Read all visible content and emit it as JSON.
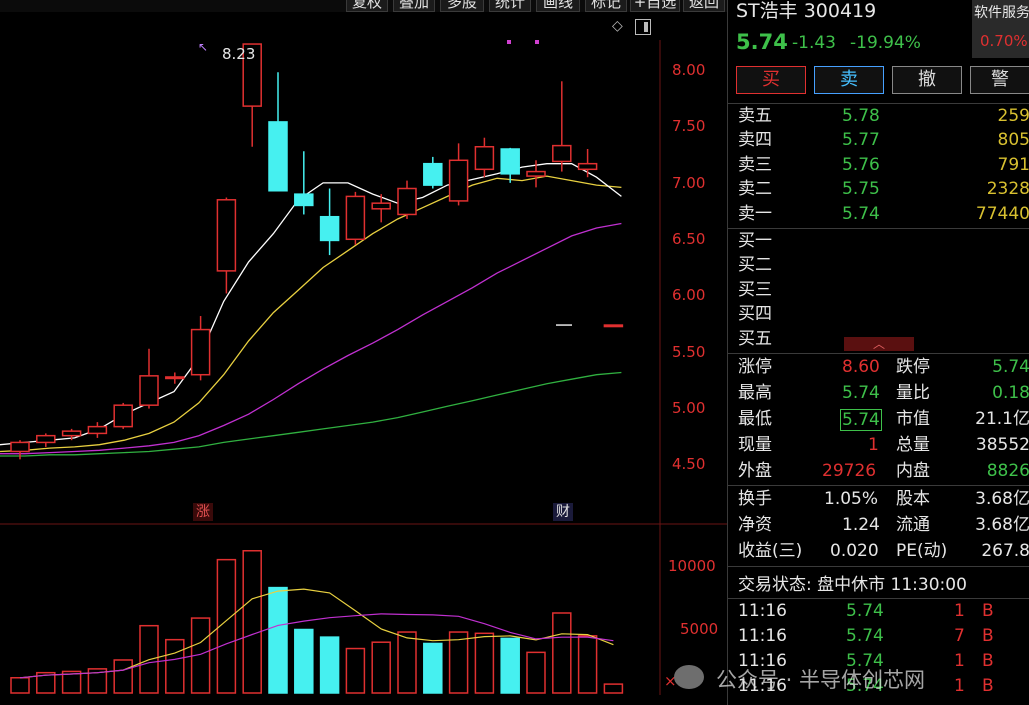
{
  "toolbar": {
    "buttons": [
      "复权",
      "叠加",
      "多股",
      "统计",
      "画线",
      "标记",
      "+自选",
      "返回"
    ]
  },
  "chart": {
    "price_axis": [
      "8.00",
      "7.50",
      "7.00",
      "6.50",
      "6.00",
      "5.50",
      "5.00",
      "4.50"
    ],
    "volume_axis": [
      "10000",
      "5000"
    ],
    "volume_unit": "×",
    "high_marker": "8.23",
    "tag_limit_up": "涨",
    "tag_finance": "财"
  },
  "stock": {
    "name_code": "ST浩丰 300419",
    "price": "5.74",
    "change": "-1.43",
    "change_pct": "-19.94%",
    "sector_label": "软件服务",
    "sector_pct": "0.70%"
  },
  "actions": {
    "buy": "买",
    "sell": "卖",
    "cancel": "撤",
    "alert": "警"
  },
  "order_book": {
    "asks": [
      {
        "label": "卖五",
        "price": "5.78",
        "vol": "259"
      },
      {
        "label": "卖四",
        "price": "5.77",
        "vol": "805"
      },
      {
        "label": "卖三",
        "price": "5.76",
        "vol": "791"
      },
      {
        "label": "卖二",
        "price": "5.75",
        "vol": "2328"
      },
      {
        "label": "卖一",
        "price": "5.74",
        "vol": "77440"
      }
    ],
    "bids": [
      {
        "label": "买一"
      },
      {
        "label": "买二"
      },
      {
        "label": "买三"
      },
      {
        "label": "买四"
      },
      {
        "label": "买五"
      }
    ]
  },
  "stats": {
    "limit_up_label": "涨停",
    "limit_up": "8.60",
    "limit_down_label": "跌停",
    "limit_down": "5.74",
    "high_label": "最高",
    "high": "5.74",
    "vol_ratio_label": "量比",
    "vol_ratio": "0.18",
    "low_label": "最低",
    "low": "5.74",
    "mkt_cap_label": "市值",
    "mkt_cap": "21.1亿",
    "cur_vol_label": "现量",
    "cur_vol": "1",
    "total_vol_label": "总量",
    "total_vol": "38552",
    "outer_label": "外盘",
    "outer": "29726",
    "inner_label": "内盘",
    "inner": "8826",
    "turnover_label": "换手",
    "turnover": "1.05%",
    "equity_label": "股本",
    "equity": "3.68亿",
    "nav_label": "净资",
    "nav": "1.24",
    "float_label": "流通",
    "float": "3.68亿",
    "eps_label": "收益(三)",
    "eps": "0.020",
    "pe_label": "PE(动)",
    "pe": "267.8"
  },
  "trade_status": "交易状态: 盘中休市 11:30:00",
  "ticks": [
    {
      "time": "11:16",
      "price": "5.74",
      "vol": "1",
      "side": "B"
    },
    {
      "time": "11:16",
      "price": "5.74",
      "vol": "7",
      "side": "B"
    },
    {
      "time": "11:16",
      "price": "5.74",
      "vol": "1",
      "side": "B"
    },
    {
      "time": "11:16",
      "price": "5.74",
      "vol": "1",
      "side": "B"
    }
  ],
  "watermark": "公众号 · 半导体创芯网",
  "colors": {
    "up": "#e03030",
    "down": "#46f0f0",
    "ma5": "#ffffff",
    "ma10": "#e8d040",
    "ma20": "#c030d0",
    "ma60": "#30b040"
  },
  "chart_data": {
    "type": "candlestick",
    "candles": [
      {
        "o": 4.62,
        "h": 4.72,
        "l": 4.55,
        "c": 4.7,
        "v": 1200
      },
      {
        "o": 4.7,
        "h": 4.78,
        "l": 4.66,
        "c": 4.76,
        "v": 1600
      },
      {
        "o": 4.76,
        "h": 4.82,
        "l": 4.72,
        "c": 4.8,
        "v": 1700
      },
      {
        "o": 4.78,
        "h": 4.88,
        "l": 4.74,
        "c": 4.84,
        "v": 1900
      },
      {
        "o": 4.84,
        "h": 5.05,
        "l": 4.82,
        "c": 5.03,
        "v": 2600
      },
      {
        "o": 5.03,
        "h": 5.53,
        "l": 5.0,
        "c": 5.29,
        "v": 5300
      },
      {
        "o": 5.27,
        "h": 5.32,
        "l": 5.22,
        "c": 5.28,
        "v": 4200
      },
      {
        "o": 5.3,
        "h": 5.82,
        "l": 5.25,
        "c": 5.7,
        "v": 5900
      },
      {
        "o": 6.22,
        "h": 6.87,
        "l": 6.02,
        "c": 6.85,
        "v": 10500
      },
      {
        "o": 7.68,
        "h": 8.23,
        "l": 7.32,
        "c": 8.23,
        "v": 11200
      },
      {
        "o": 7.54,
        "h": 7.98,
        "l": 6.93,
        "c": 6.93,
        "v": 8300
      },
      {
        "o": 6.9,
        "h": 7.28,
        "l": 6.72,
        "c": 6.8,
        "v": 5000
      },
      {
        "o": 6.7,
        "h": 6.95,
        "l": 6.36,
        "c": 6.49,
        "v": 4400
      },
      {
        "o": 6.5,
        "h": 6.92,
        "l": 6.45,
        "c": 6.88,
        "v": 3500
      },
      {
        "o": 6.77,
        "h": 6.9,
        "l": 6.65,
        "c": 6.82,
        "v": 4000
      },
      {
        "o": 6.72,
        "h": 7.02,
        "l": 6.68,
        "c": 6.95,
        "v": 4800
      },
      {
        "o": 7.17,
        "h": 7.23,
        "l": 6.95,
        "c": 6.98,
        "v": 3900
      },
      {
        "o": 6.84,
        "h": 7.35,
        "l": 6.8,
        "c": 7.2,
        "v": 4800
      },
      {
        "o": 7.12,
        "h": 7.4,
        "l": 7.05,
        "c": 7.32,
        "v": 4700
      },
      {
        "o": 7.3,
        "h": 7.31,
        "l": 7.0,
        "c": 7.08,
        "v": 4300
      },
      {
        "o": 7.06,
        "h": 7.2,
        "l": 6.96,
        "c": 7.1,
        "v": 3200
      },
      {
        "o": 7.19,
        "h": 7.9,
        "l": 7.1,
        "c": 7.33,
        "v": 6300
      },
      {
        "o": 7.12,
        "h": 7.3,
        "l": 7.05,
        "c": 7.17,
        "v": 4500
      },
      {
        "o": 5.74,
        "h": 5.74,
        "l": 5.74,
        "c": 5.74,
        "v": 700
      }
    ],
    "ma5": [
      4.68,
      4.7,
      4.72,
      4.74,
      4.82,
      4.95,
      5.05,
      5.15,
      5.45,
      5.95,
      6.3,
      6.55,
      6.85,
      7.0,
      7.0,
      6.9,
      6.82,
      6.87,
      6.98,
      7.03,
      7.08,
      7.14,
      7.17,
      7.17,
      7.05,
      6.88
    ],
    "ma10": [
      4.62,
      4.63,
      4.65,
      4.66,
      4.68,
      4.72,
      4.78,
      4.88,
      5.05,
      5.3,
      5.6,
      5.85,
      6.05,
      6.25,
      6.4,
      6.55,
      6.68,
      6.78,
      6.88,
      6.98,
      7.04,
      7.02,
      7.06,
      7.02,
      6.98,
      6.96
    ],
    "ma20": [
      4.6,
      4.6,
      4.61,
      4.62,
      4.63,
      4.65,
      4.67,
      4.7,
      4.76,
      4.85,
      4.95,
      5.08,
      5.22,
      5.35,
      5.47,
      5.58,
      5.7,
      5.83,
      5.95,
      6.07,
      6.2,
      6.31,
      6.42,
      6.53,
      6.6,
      6.64
    ],
    "ma60": [
      4.58,
      4.58,
      4.59,
      4.59,
      4.6,
      4.61,
      4.62,
      4.64,
      4.66,
      4.7,
      4.73,
      4.76,
      4.79,
      4.82,
      4.85,
      4.88,
      4.92,
      4.97,
      5.02,
      5.07,
      5.12,
      5.17,
      5.22,
      5.26,
      5.3,
      5.32
    ],
    "ylim": [
      4.45,
      8.3
    ],
    "vol_ylim": [
      0,
      12000
    ]
  }
}
